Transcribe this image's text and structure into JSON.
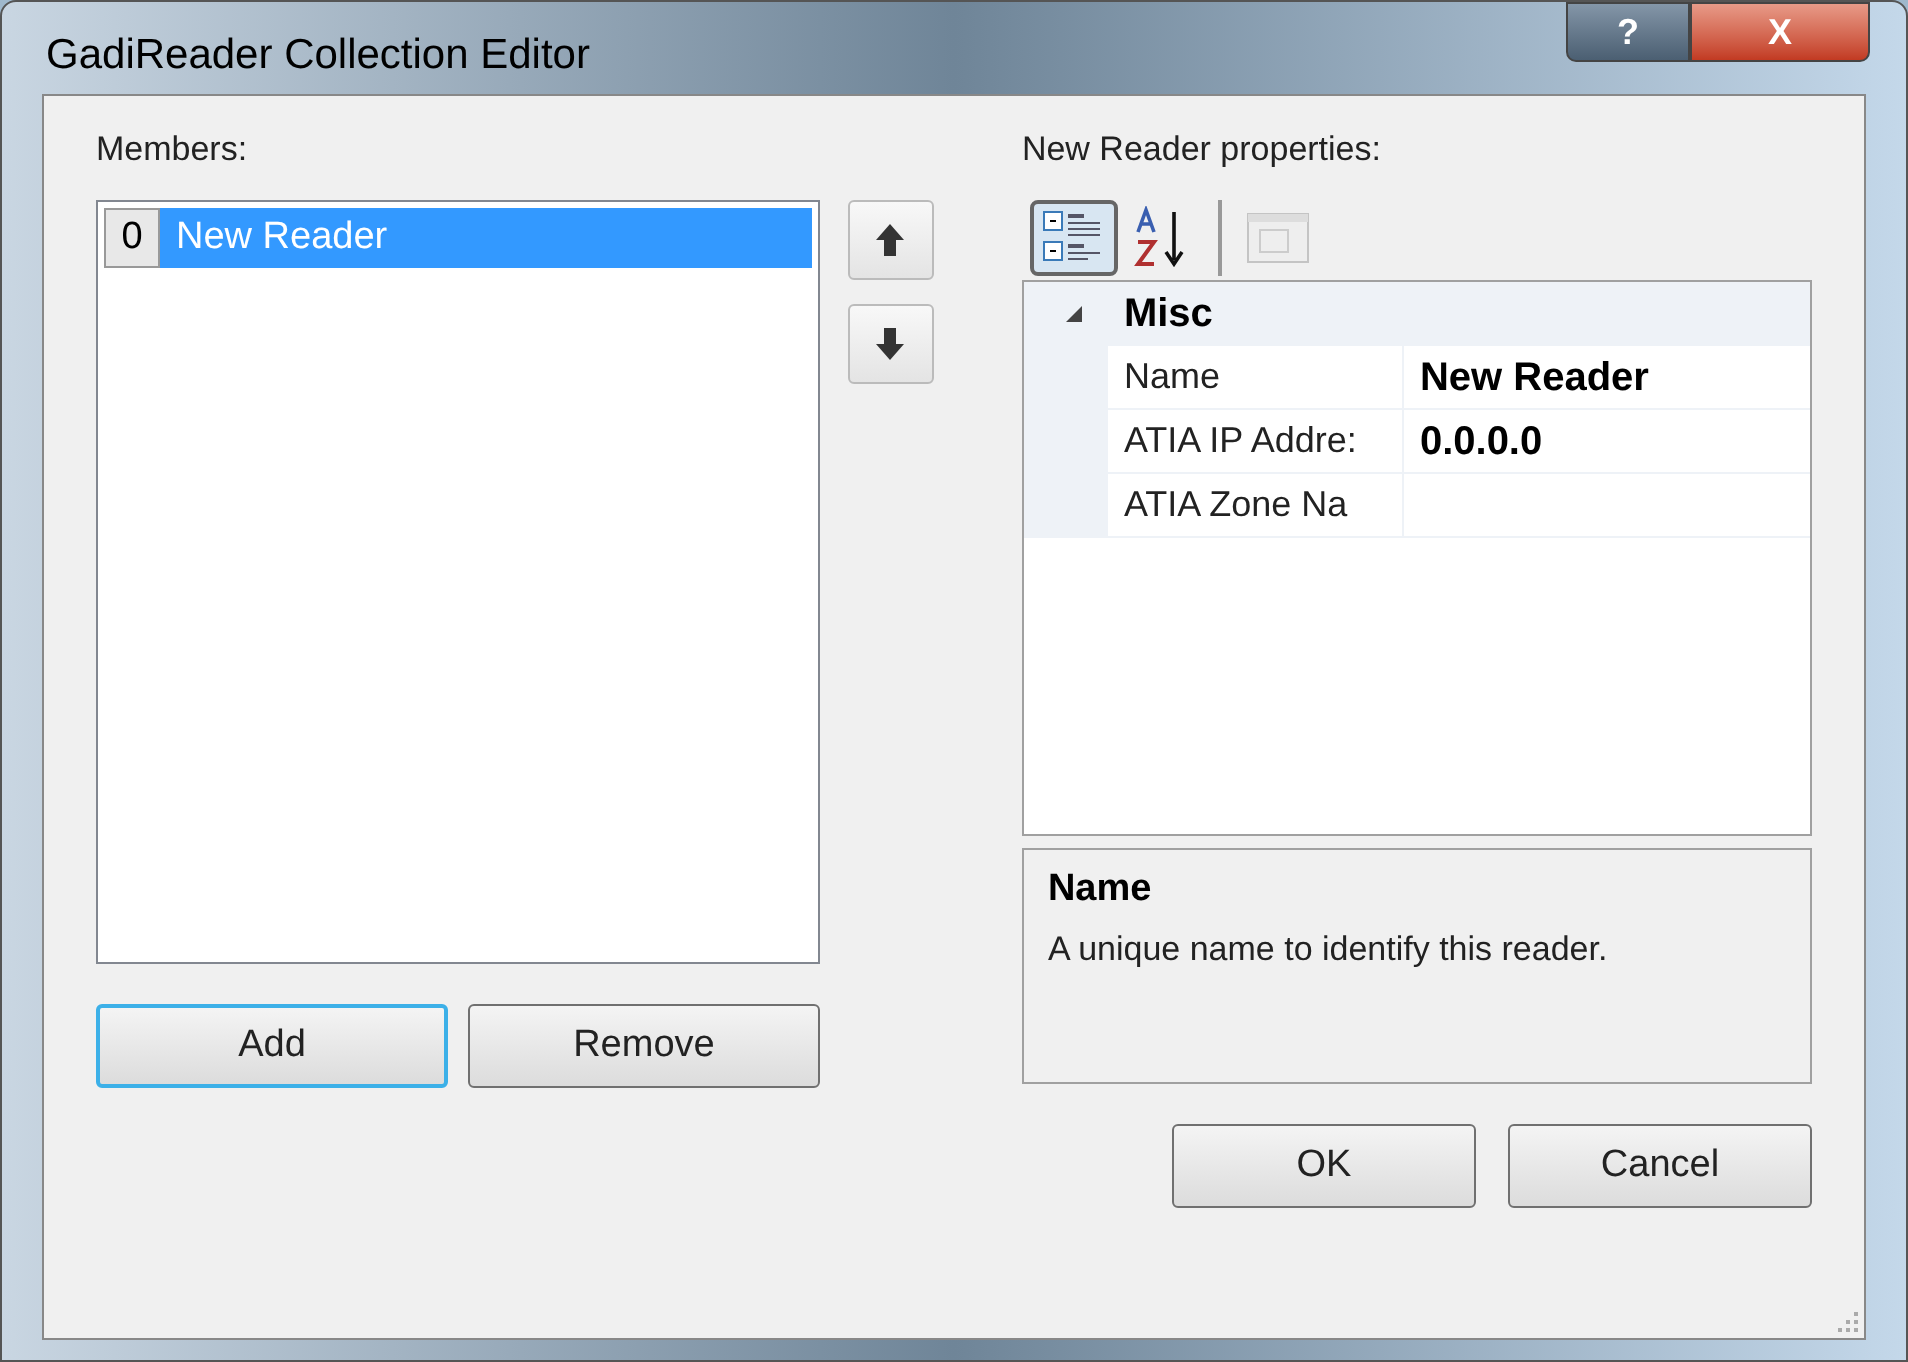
{
  "window": {
    "title": "GadiReader Collection Editor",
    "buttons": [
      {
        "kind": "help",
        "label": "?"
      },
      {
        "kind": "close",
        "label": "X"
      }
    ]
  },
  "members": {
    "label": "Members:",
    "items": [
      {
        "index": "0",
        "name": "New Reader",
        "selected": true
      }
    ]
  },
  "properties": {
    "label": "New Reader properties:",
    "toolbar": [
      {
        "kind": "categorized",
        "selected": true
      },
      {
        "kind": "alphabetical",
        "selected": false
      },
      {
        "kind": "pages",
        "disabled": true
      }
    ],
    "category": {
      "name": "Misc",
      "expanded": true
    },
    "rows": [
      {
        "name": "Name",
        "value": "New Reader",
        "modified": true
      },
      {
        "name": "ATIA IP Addre:",
        "value": "0.0.0.0",
        "modified": true
      },
      {
        "name": "ATIA Zone Na"
      }
    ],
    "description": {
      "title": "Name",
      "text": "A unique name to identify this reader."
    }
  },
  "buttons": [
    {
      "label": "Add",
      "default": true
    },
    {
      "label": "Remove",
      "default": false
    },
    {
      "label": "OK",
      "default": false
    },
    {
      "label": "Cancel",
      "default": false
    }
  ]
}
